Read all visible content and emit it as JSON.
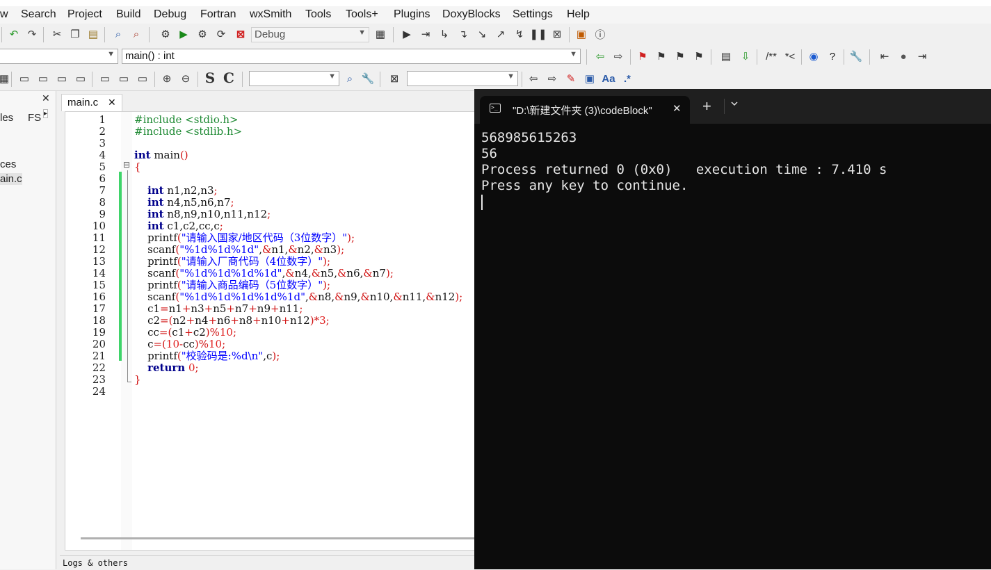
{
  "menu": [
    "w",
    "Search",
    "Project",
    "Build",
    "Debug",
    "Fortran",
    "wxSmith",
    "Tools",
    "Tools+",
    "Plugins",
    "DoxyBlocks",
    "Settings",
    "Help"
  ],
  "toolbar": {
    "build_target": "Debug",
    "function_scope": "main() : int",
    "doc_comment_label": "/**",
    "inline_comment_label": "*<",
    "sym_s": "S",
    "sym_c": "C",
    "regex_label": "Aa",
    "regex_dot": ".*"
  },
  "left_panel": {
    "close": "✕",
    "tabs": [
      "les",
      "FS"
    ],
    "tree": [
      "ces",
      "ain.c"
    ]
  },
  "editor": {
    "tab_label": "main.c",
    "tab_close": "✕",
    "line_numbers": [
      "1",
      "2",
      "3",
      "4",
      "5",
      "6",
      "7",
      "8",
      "9",
      "10",
      "11",
      "12",
      "13",
      "14",
      "15",
      "16",
      "17",
      "18",
      "19",
      "20",
      "21",
      "22",
      "23",
      "24"
    ],
    "fold_marker": "⊟",
    "lines": [
      "#include <stdio.h>",
      "#include <stdlib.h>",
      "",
      "int main()",
      "{",
      "",
      "    int n1,n2,n3;",
      "    int n4,n5,n6,n7;",
      "    int n8,n9,n10,n11,n12;",
      "    int c1,c2,cc,c;",
      "    printf(\"请输入国家/地区代码（3位数字）\");",
      "    scanf(\"%1d%1d%1d\",&n1,&n2,&n3);",
      "    printf(\"请输入厂商代码（4位数字）\");",
      "    scanf(\"%1d%1d%1d%1d\",&n4,&n5,&n6,&n7);",
      "    printf(\"请输入商品编码（5位数字）\");",
      "    scanf(\"%1d%1d%1d%1d%1d\",&n8,&n9,&n10,&n11,&n12);",
      "    c1=n1+n3+n5+n7+n9+n11;",
      "    c2=(n2+n4+n6+n8+n10+n12)*3;",
      "    cc=(c1+c2)%10;",
      "    c=(10-cc)%10;",
      "    printf(\"校验码是:%d\\n\",c);",
      "    return 0;",
      "}",
      ""
    ]
  },
  "bottom_panel": {
    "logs_label": "Logs & others"
  },
  "terminal": {
    "tab_title": "\"D:\\新建文件夹 (3)\\codeBlock\"",
    "tab_close": "✕",
    "new_tab": "+",
    "dropdown": "⌄",
    "output_lines": [
      "568985615263",
      "56",
      "Process returned 0 (0x0)   execution time : 7.410 s",
      "Press any key to continue."
    ]
  },
  "colors": {
    "keyword": "#00008b",
    "string": "#0000ff",
    "preprocessor": "#1f8a34",
    "number": "#e02020",
    "change_bar": "#3fd46a",
    "terminal_bg": "#0c0c0c"
  }
}
